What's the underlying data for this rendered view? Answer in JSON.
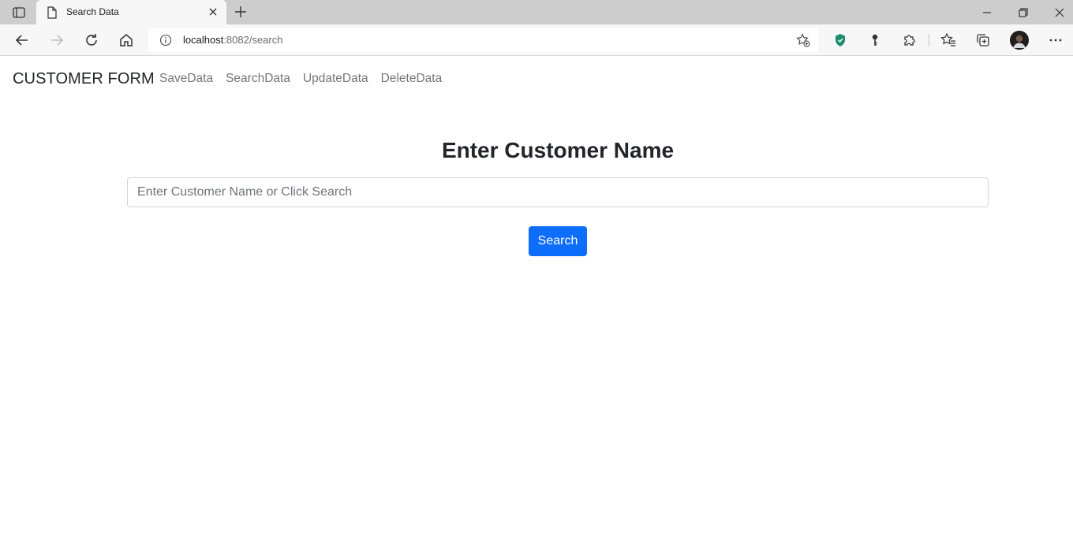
{
  "browser": {
    "tab_title": "Search Data",
    "url_host": "localhost",
    "url_rest": ":8082/search",
    "icons": {
      "tab_actions": "tab-actions-icon",
      "page": "page-icon",
      "close": "close-icon",
      "new_tab": "plus-icon",
      "back": "back-arrow-icon",
      "forward": "forward-arrow-icon",
      "refresh": "refresh-icon",
      "home": "home-icon",
      "info": "info-icon",
      "add_favorite": "add-favorite-icon",
      "shield": "shield-icon",
      "key": "key-icon",
      "extensions": "puzzle-icon",
      "favorites": "favorites-icon",
      "collections": "collections-icon",
      "more": "more-icon"
    },
    "accent_shield": "#1e8e6e"
  },
  "navbar": {
    "brand": "CUSTOMER FORM",
    "links": [
      "SaveData",
      "SearchData",
      "UpdateData",
      "DeleteData"
    ]
  },
  "main": {
    "heading": "Enter Customer Name",
    "search": {
      "placeholder": "Enter Customer Name or Click Search",
      "value": ""
    },
    "search_button": "Search"
  },
  "colors": {
    "primary": "#0d6efd",
    "text": "#212529",
    "nav_link": "#6c6c6c"
  }
}
